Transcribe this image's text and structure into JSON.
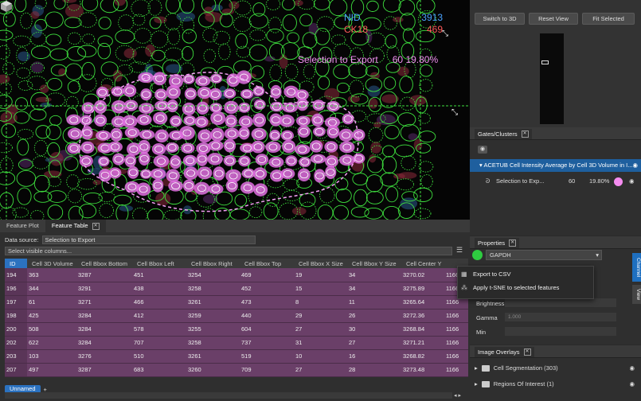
{
  "viewer": {
    "legend": [
      {
        "name": "NID",
        "value": "3913",
        "color": "#4aa3ff"
      },
      {
        "name": "CK18",
        "value": "469",
        "color": "#ff5a5a"
      }
    ],
    "selection": {
      "label": "Selection to Export",
      "count": "60",
      "percent": "19.80%",
      "color": "#f090f0"
    }
  },
  "top_panel": {
    "buttons": [
      {
        "label": "Switch to 3D"
      },
      {
        "label": "Reset View"
      },
      {
        "label": "Fit Selected"
      }
    ]
  },
  "gates": {
    "tab_label": "Gates/Clusters",
    "gate_row": "ACETUB Cell Intensity Average by Cell 3D Volume in I...",
    "sub": {
      "name": "Selection to Exp...",
      "count": "60",
      "percent": "19.80%"
    }
  },
  "properties": {
    "tab_label": "Properties",
    "channel": "GAPDH",
    "labels": [
      "Brightness",
      "Gamma",
      "Min"
    ],
    "gamma_value": "1.000",
    "vtabs": [
      "Channel",
      "View"
    ]
  },
  "context_menu": {
    "items": [
      {
        "label": "Export to CSV",
        "icon": "table-icon"
      },
      {
        "label": "Apply t-SNE to selected features",
        "icon": "tsne-icon"
      }
    ]
  },
  "overlays": {
    "tab_label": "Image Overlays",
    "rows": [
      {
        "label": "Cell Segmentation (303)"
      },
      {
        "label": "Regions Of Interest (1)"
      }
    ]
  },
  "bottom": {
    "tabs": [
      {
        "label": "Feature Plot"
      },
      {
        "label": "Feature Table"
      }
    ],
    "data_source_label": "Data source:",
    "data_source_value": "Selection to Export",
    "columns_placeholder": "Select visible columns...",
    "headers": [
      "ID",
      "Cell 3D Volume",
      "Cell Bbox Bottom",
      "Cell Bbox Left",
      "Cell Bbox Right",
      "Cell Bbox Top",
      "Cell Bbox X Size",
      "Cell Bbox Y Size",
      "Cell Center Y"
    ],
    "rows": [
      [
        "194",
        "363",
        "3287",
        "451",
        "3254",
        "469",
        "19",
        "34",
        "3270.02",
        "1166"
      ],
      [
        "196",
        "344",
        "3291",
        "438",
        "3258",
        "452",
        "15",
        "34",
        "3275.89",
        "1166"
      ],
      [
        "197",
        "61",
        "3271",
        "466",
        "3261",
        "473",
        "8",
        "11",
        "3265.64",
        "1166"
      ],
      [
        "198",
        "425",
        "3284",
        "412",
        "3259",
        "440",
        "29",
        "26",
        "3272.36",
        "1166"
      ],
      [
        "200",
        "508",
        "3284",
        "578",
        "3255",
        "604",
        "27",
        "30",
        "3268.84",
        "1166"
      ],
      [
        "202",
        "622",
        "3284",
        "707",
        "3258",
        "737",
        "31",
        "27",
        "3271.21",
        "1166"
      ],
      [
        "203",
        "103",
        "3276",
        "510",
        "3261",
        "519",
        "10",
        "16",
        "3268.82",
        "1166"
      ],
      [
        "207",
        "497",
        "3287",
        "683",
        "3260",
        "709",
        "27",
        "28",
        "3273.48",
        "1166"
      ]
    ],
    "sheet_tab": "Unnamed"
  }
}
